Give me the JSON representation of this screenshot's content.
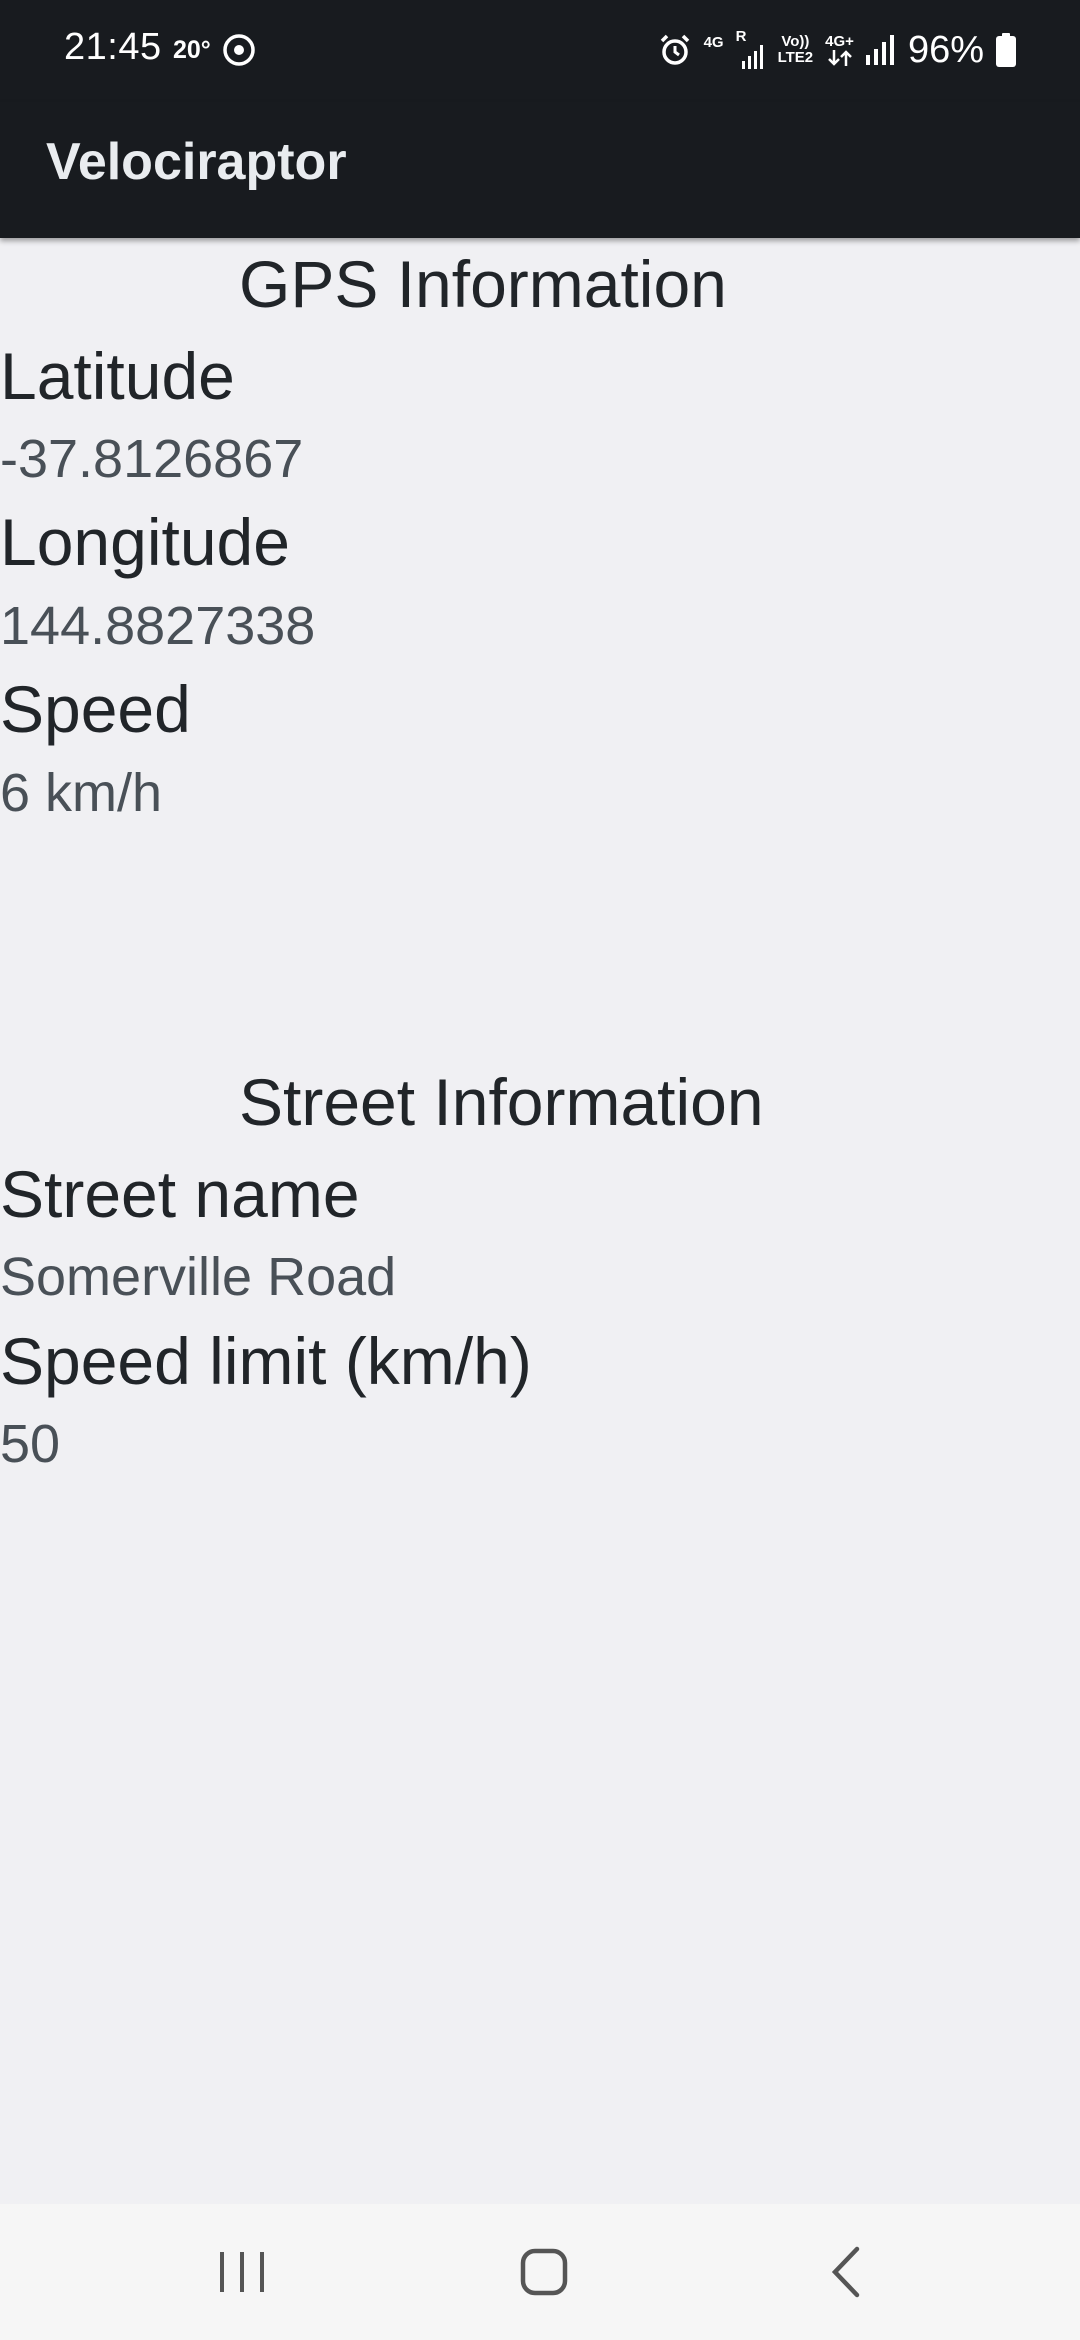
{
  "status_bar": {
    "time": "21:45",
    "temperature": "20°",
    "net_4g": "4G",
    "net_r": "R",
    "net_volte_top": "Vo))",
    "net_volte_bottom": "LTE2",
    "net_4g_plus": "4G+",
    "battery": "96%",
    "icons": [
      "location-icon",
      "alarm-icon",
      "signal-icon",
      "data-arrows-icon",
      "battery-icon"
    ]
  },
  "app_bar": {
    "title": "Velociraptor"
  },
  "gps": {
    "heading": "GPS Information",
    "latitude_label": "Latitude",
    "latitude_value": "-37.8126867",
    "longitude_label": "Longitude",
    "longitude_value": "144.8827338",
    "speed_label": "Speed",
    "speed_value": "6 km/h"
  },
  "street": {
    "heading": "Street Information",
    "name_label": "Street name",
    "name_value": "Somerville Road",
    "limit_label": "Speed limit (km/h)",
    "limit_value": "50"
  },
  "nav_bar": {
    "icons": [
      "recent-apps-icon",
      "home-icon",
      "back-icon"
    ]
  },
  "colors": {
    "app_bar": "#181b1f",
    "background": "#f0f0f3",
    "label_text": "#212529",
    "value_text": "#495057"
  }
}
